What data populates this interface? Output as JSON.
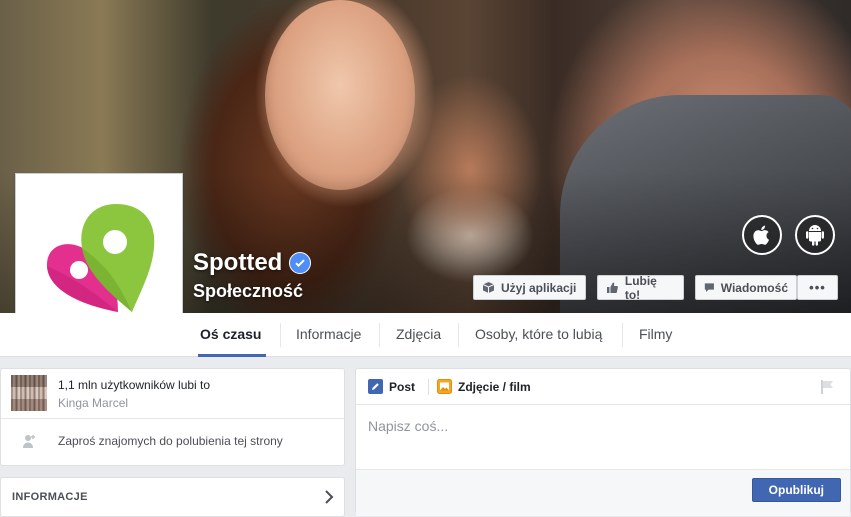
{
  "page": {
    "name": "Spotted",
    "category": "Społeczność"
  },
  "cover_actions": {
    "use_app": "Użyj aplikacji",
    "like": "Lubię to!",
    "message": "Wiadomość",
    "more": "•••"
  },
  "platforms": [
    "apple-icon",
    "android-icon"
  ],
  "nav": {
    "tabs": [
      {
        "label": "Oś czasu",
        "active": true
      },
      {
        "label": "Informacje"
      },
      {
        "label": "Zdjęcia"
      },
      {
        "label": "Osoby, które to lubią"
      },
      {
        "label": "Filmy"
      }
    ]
  },
  "likes": {
    "count_text": "1,1 mln użytkowników lubi to",
    "friend": "Kinga Marcel",
    "invite": "Zaproś znajomych do polubienia tej strony"
  },
  "info": {
    "title": "INFORMACJE"
  },
  "composer": {
    "tab_post": "Post",
    "tab_photo": "Zdjęcie / film",
    "placeholder": "Napisz coś...",
    "publish": "Opublikuj"
  },
  "colors": {
    "accent": "#4267b2",
    "verified": "#4f8ef7",
    "logo_green": "#8cc63f",
    "logo_pink": "#e3308f"
  }
}
